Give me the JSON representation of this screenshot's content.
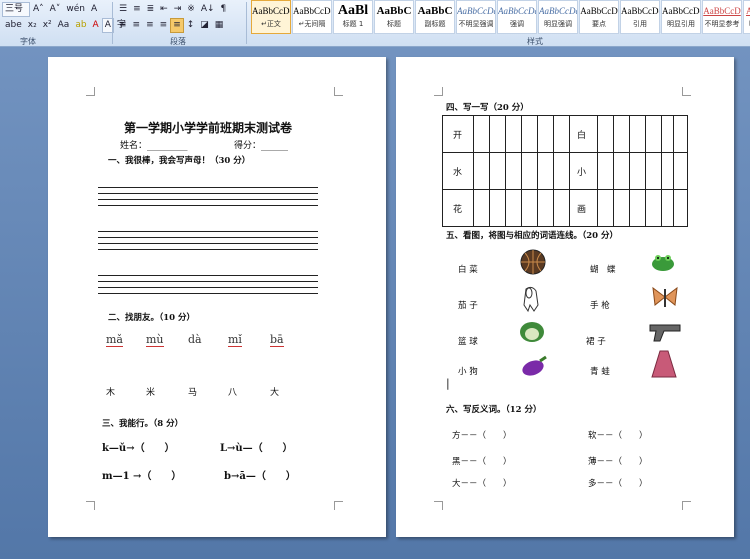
{
  "ribbon": {
    "font_size": "三号",
    "group_font": "字体",
    "group_paragraph": "段落",
    "group_styles": "样式",
    "styles": [
      {
        "sample": "AaBbCcDc",
        "name": "↵正文"
      },
      {
        "sample": "AaBbCcDc",
        "name": "↵无间隔"
      },
      {
        "sample": "AaBl",
        "name": "标题 1"
      },
      {
        "sample": "AaBbC",
        "name": "标题"
      },
      {
        "sample": "AaBbC",
        "name": "副标题"
      },
      {
        "sample": "AaBbCcDc",
        "name": "不明显强调"
      },
      {
        "sample": "AaBbCcDc",
        "name": "强调"
      },
      {
        "sample": "AaBbCcDc",
        "name": "明显强调"
      },
      {
        "sample": "AaBbCcD",
        "name": "要点"
      },
      {
        "sample": "AaBbCcDc",
        "name": "引用"
      },
      {
        "sample": "AaBbCcDc",
        "name": "明显引用"
      },
      {
        "sample": "AaBbCcD",
        "name": "不明显参考"
      },
      {
        "sample": "AaBbCcI",
        "name": "明显参考"
      }
    ]
  },
  "left": {
    "title": "第一学期小学学前班期末测试卷",
    "name_label": "姓名：_________",
    "score_label": "得分：______",
    "s1": "一、我很棒，我会写声母！（30 分）",
    "s2": "二、找朋友。（10 分）",
    "pinyin": [
      "mǎ",
      "mù",
      "dà",
      "mǐ",
      "bā"
    ],
    "chars": [
      "木",
      "米",
      "马",
      "八",
      "大"
    ],
    "s3": "三、我能行。（8 分）",
    "e1": "k—ǔ→（　　）",
    "e2": "L→ù—（　　）",
    "e3": "m—1 →（　　）",
    "e4": "b→ā—（　　）"
  },
  "right": {
    "s4": "四、写一写（20 分）",
    "grid_left": [
      "开",
      "水",
      "花"
    ],
    "grid_right": [
      "白",
      "小",
      "画"
    ],
    "s5": "五、看图，将图与相应的词语连线。（20 分）",
    "words_left": [
      "白 菜",
      "茄 子",
      "篮 球",
      "小 狗"
    ],
    "words_right": [
      "蝴　蝶",
      "手 枪",
      "裙 子",
      "青 蛙"
    ],
    "s6": "六、写反义词。（12 分）",
    "ant_left": [
      "方－－（　　）",
      "黑－－（　　）",
      "大－－（　　）"
    ],
    "ant_right": [
      "软－－（　　）",
      "薄－－（　　）",
      "多－－（　　）"
    ]
  }
}
